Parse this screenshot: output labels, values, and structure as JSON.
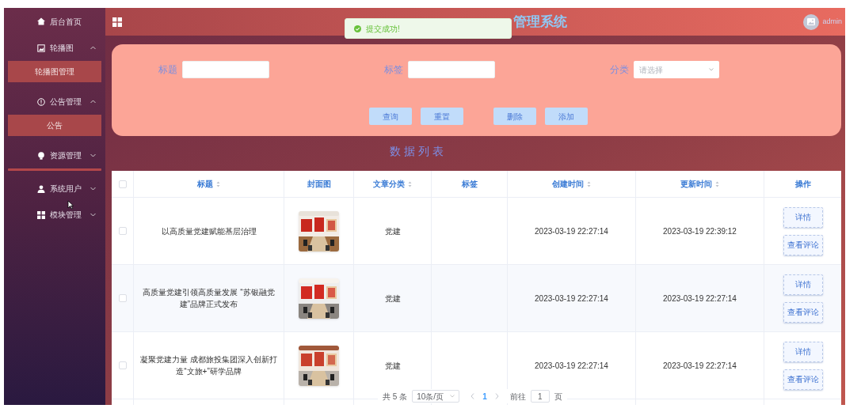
{
  "sidebar": {
    "items": [
      {
        "kind": "link",
        "label": "后台首页"
      },
      {
        "kind": "group",
        "label": "轮播图",
        "expanded": true,
        "children": [
          {
            "label": "轮播图管理",
            "selected": true
          }
        ]
      },
      {
        "kind": "group",
        "label": "公告管理",
        "expanded": true,
        "children": [
          {
            "label": "公告",
            "selected": true
          }
        ]
      },
      {
        "kind": "group",
        "label": "资源管理",
        "expanded": false
      },
      {
        "kind": "divider"
      },
      {
        "kind": "group",
        "label": "系统用户",
        "expanded": false
      },
      {
        "kind": "group",
        "label": "模块管理",
        "expanded": false
      }
    ]
  },
  "header": {
    "title": "管理系统",
    "toast": "提交成功!",
    "user": "admin"
  },
  "search": {
    "fields": [
      {
        "kind": "input",
        "label": "标题"
      },
      {
        "kind": "input",
        "label": "标签"
      },
      {
        "kind": "select",
        "label": "分类",
        "placeholder": "请选择"
      }
    ],
    "buttons": [
      {
        "kind": "search",
        "label": "查询"
      },
      {
        "kind": "reset",
        "label": "重置"
      },
      {
        "kind": "delete",
        "label": "删除"
      },
      {
        "kind": "add",
        "label": "添加"
      }
    ]
  },
  "section_title": "数 据 列 表",
  "table": {
    "header_checked": false,
    "columns": [
      {
        "label": "标题",
        "sortable": true
      },
      {
        "label": "封面图",
        "sortable": false
      },
      {
        "label": "文章分类",
        "sortable": true
      },
      {
        "label": "标签",
        "sortable": false
      },
      {
        "label": "创建时间",
        "sortable": true
      },
      {
        "label": "更新时间",
        "sortable": true
      },
      {
        "label": "操作",
        "sortable": false
      }
    ],
    "rows": [
      {
        "checked": false,
        "title": "以高质量党建赋能基层治理",
        "cover": {
          "kind": "picture"
        },
        "category": "党建",
        "created": "2023-03-19 22:27:14",
        "updated": "2023-03-19 22:39:12",
        "actions": [
          "详情",
          "查看评论"
        ]
      },
      {
        "checked": false,
        "title": "高质量党建引领高质量发展 “苏银融党建”品牌正式发布",
        "cover": {
          "kind": "picture"
        },
        "category": "党建",
        "created": "2023-03-19 22:27:14",
        "updated": "2023-03-19 22:27:14",
        "actions": [
          "详情",
          "查看评论"
        ]
      },
      {
        "checked": false,
        "title": "凝聚党建力量 成都旅投集团深入创新打造“文旅+”研学品牌",
        "cover": {
          "kind": "picture"
        },
        "category": "党建",
        "created": "2023-03-19 22:27:14",
        "updated": "2023-03-19 22:27:14",
        "actions": [
          "详情",
          "查看评论"
        ]
      }
    ]
  },
  "pagination": {
    "total": "共 5 条",
    "page_size": "10条/页",
    "pages": [
      {
        "label": "1",
        "selected": true
      }
    ],
    "goto_label": "前往",
    "goto_value": "1",
    "goto_suffix": "页"
  }
}
